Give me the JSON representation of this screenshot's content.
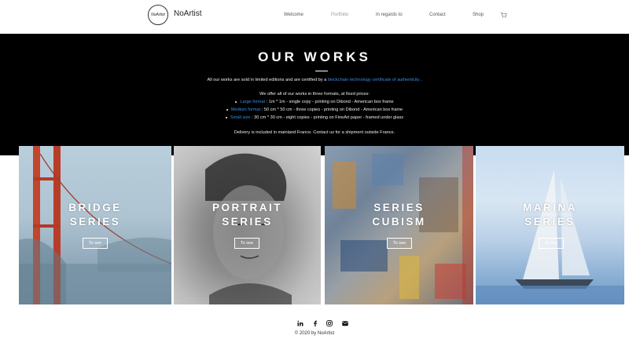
{
  "header": {
    "logo_text": "NoArtist",
    "brand": "NoArtist",
    "nav": [
      "Welcome",
      "Portfolio",
      "In regards to",
      "Contact",
      "Shop"
    ],
    "active_nav": "Portfolio",
    "cart_icon": "cart-icon"
  },
  "works": {
    "title": "OUR WORKS",
    "intro_before": "All our works are sold in limited editions and are certified by a ",
    "intro_link": "blockchain technology certificate of authenticity",
    "intro_after": " .",
    "formats_intro": "We offer all of our works in three formats, at fixed prices:",
    "formats": [
      {
        "name": "Large format",
        "desc": " : 1m * 1m - single copy - printing on Dibond - American box frame"
      },
      {
        "name": "Medium format",
        "desc": " : 50 cm * 50 cm - three copies - printing on Dibond - American box frame"
      },
      {
        "name": "Small size",
        "desc": " : 30 cm * 30 cm - eight copies - printing on FineArt paper - framed under glass"
      }
    ],
    "delivery": "Delivery is included in mainland France. Contact us for a shipment outside France."
  },
  "series": [
    {
      "line1": "BRIDGE",
      "line2": "SERIES",
      "button": "To see"
    },
    {
      "line1": "PORTRAIT",
      "line2": "SERIES",
      "button": "To see"
    },
    {
      "line1": "SERIES",
      "line2": "CUBISM",
      "button": "To see"
    },
    {
      "line1": "MARINA",
      "line2": "SERIES",
      "button": "To see"
    }
  ],
  "footer": {
    "social_icons": [
      "linkedin-icon",
      "facebook-icon",
      "instagram-icon",
      "mail-icon"
    ],
    "copyright": "© 2020 by NoArtist"
  },
  "colors": {
    "link": "#3b8fe0",
    "band": "#000000"
  }
}
